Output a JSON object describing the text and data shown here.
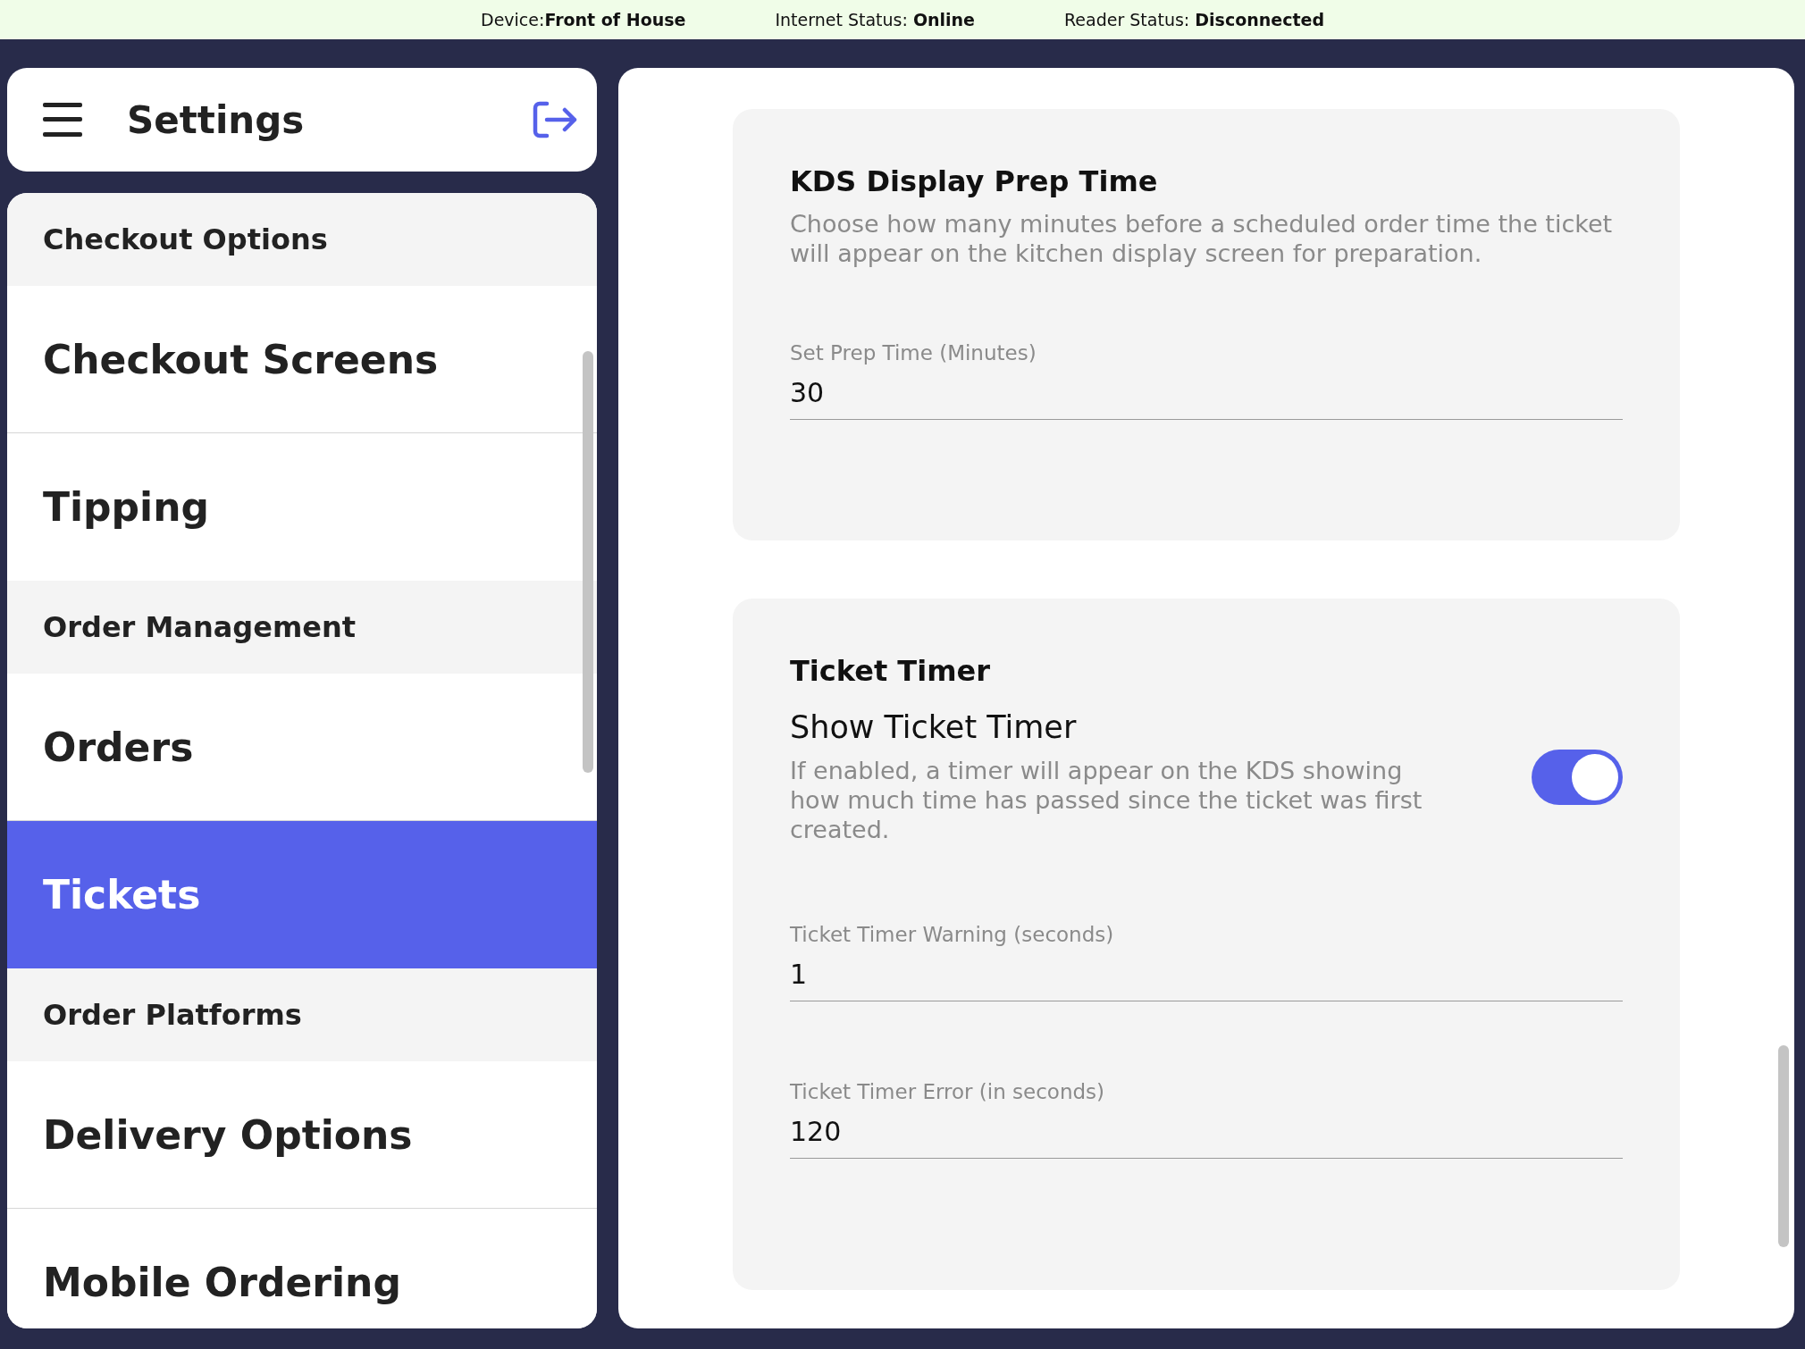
{
  "status_bar": [
    {
      "label": "Device:",
      "value": "Front of House"
    },
    {
      "label": "Internet Status: ",
      "value": "Online"
    },
    {
      "label": "Reader Status: ",
      "value": "Disconnected"
    }
  ],
  "header": {
    "title": "Settings"
  },
  "sidebar": {
    "sections": [
      {
        "title": "Checkout Options",
        "items": [
          {
            "label": "Checkout Screens",
            "selected": false
          },
          {
            "label": "Tipping",
            "selected": false
          }
        ]
      },
      {
        "title": "Order Management",
        "items": [
          {
            "label": "Orders",
            "selected": false
          },
          {
            "label": "Tickets",
            "selected": true
          }
        ]
      },
      {
        "title": "Order Platforms",
        "items": [
          {
            "label": "Delivery Options",
            "selected": false
          },
          {
            "label": "Mobile Ordering",
            "selected": false
          }
        ]
      }
    ]
  },
  "cards": [
    {
      "title": "KDS Display Prep Time",
      "description": "Choose how many minutes before a scheduled order time the ticket will appear on the kitchen display screen for preparation.",
      "rows": [
        {
          "kind": "field",
          "label": "Set Prep Time (Minutes)",
          "value": "30"
        }
      ]
    },
    {
      "title": "Ticket Timer",
      "rows": [
        {
          "kind": "toggle",
          "label": "Show Ticket Timer",
          "description": "If enabled, a timer will appear on the KDS showing how much time has passed since the ticket was first created.",
          "on": true
        },
        {
          "kind": "field",
          "label": "Ticket Timer Warning (seconds)",
          "value": "1"
        },
        {
          "kind": "field",
          "label": "Ticket Timer Error (in seconds)",
          "value": "120"
        }
      ]
    }
  ]
}
